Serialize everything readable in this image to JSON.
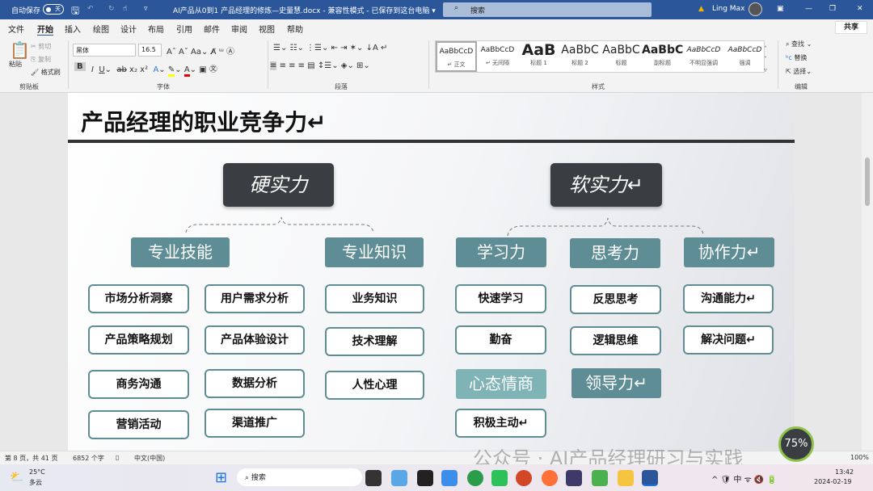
{
  "titlebar": {
    "autosave": "自动保存",
    "autosave_state": "关",
    "doc_title": "AI产品从0到1 产品经理的修炼—史量慧.docx  -  兼容性模式  -  已保存到这台电脑  ▾",
    "search": "搜索",
    "user": "Ling Max"
  },
  "menu": [
    "文件",
    "开始",
    "插入",
    "绘图",
    "设计",
    "布局",
    "引用",
    "邮件",
    "审阅",
    "视图",
    "帮助"
  ],
  "share": "共享",
  "ribbon": {
    "clipboard": {
      "paste": "粘贴",
      "cut": "剪切",
      "copy": "复制",
      "format_painter": "格式刷",
      "label": "剪贴板"
    },
    "font": {
      "name": "黑体",
      "size": "16.5",
      "label": "字体"
    },
    "paragraph": {
      "label": "段落"
    },
    "styles": {
      "items": [
        {
          "sample": "AaBbCcD",
          "name": "↵ 正文"
        },
        {
          "sample": "AaBbCcD",
          "name": "↵ 无间隔"
        },
        {
          "sample": "AaB",
          "name": "标题 1"
        },
        {
          "sample": "AaBbC",
          "name": "标题 2"
        },
        {
          "sample": "AaBbC",
          "name": "标题"
        },
        {
          "sample": "AaBbC",
          "name": "副标题"
        },
        {
          "sample": "AaBbCcD",
          "name": "不明显强调"
        },
        {
          "sample": "AaBbCcD",
          "name": "强调"
        }
      ],
      "label": "样式"
    },
    "editing": {
      "find": "查找",
      "replace": "替换",
      "select": "选择",
      "label": "编辑"
    }
  },
  "document": {
    "title": "产品经理的职业竞争力↵",
    "hard": "硬实力",
    "soft": "软实力↵",
    "categories": [
      "专业技能",
      "专业知识",
      "学习力",
      "思考力",
      "协作力↵",
      "心态情商",
      "领导力↵"
    ],
    "skills": {
      "col1": [
        "市场分析洞察",
        "产品策略规划",
        "商务沟通",
        "营销活动"
      ],
      "col2": [
        "用户需求分析",
        "产品体验设计",
        "数据分析",
        "渠道推广"
      ],
      "col3": [
        "业务知识",
        "技术理解",
        "人性心理"
      ],
      "col4": [
        "快速学习",
        "勤奋",
        "积极主动↵"
      ],
      "col5": [
        "反思思考",
        "逻辑思维"
      ],
      "col6": [
        "沟通能力↵",
        "解决问题↵"
      ]
    }
  },
  "watermark": "公众号 · AI产品经理研习与实践",
  "speed_widget": "75%",
  "status": {
    "page": "第 8 页，共 41 页",
    "words": "6852 个字",
    "lang": "中文(中国)",
    "zoom": "100%"
  },
  "taskbar": {
    "weather_temp": "25°C",
    "weather_desc": "多云",
    "search": "搜索",
    "time": "13:42",
    "date": "2024-02-19"
  }
}
